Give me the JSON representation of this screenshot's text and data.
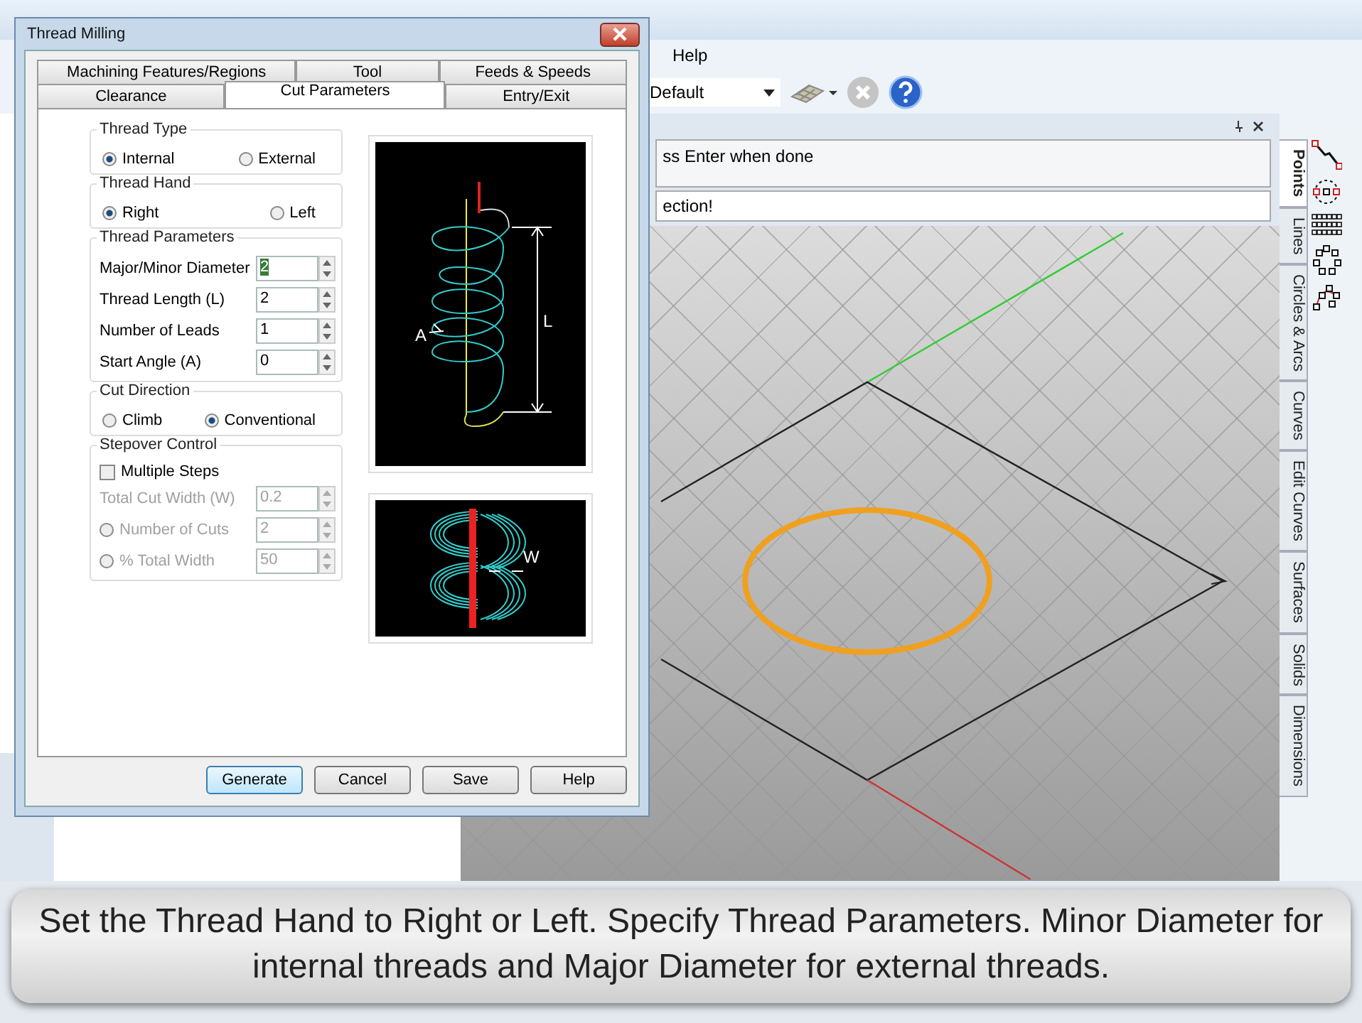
{
  "app": {
    "menu": [
      {
        "label": "Help"
      }
    ],
    "toolbar": {
      "view_dropdown": "Default"
    },
    "command_panel": {
      "prompt": "ss Enter when done",
      "message": "ection!"
    },
    "side_tabs": [
      {
        "label": "Points",
        "selected": true
      },
      {
        "label": "Lines",
        "selected": false
      },
      {
        "label": "Circles & Arcs",
        "selected": false
      },
      {
        "label": "Curves",
        "selected": false
      },
      {
        "label": "Edit Curves",
        "selected": false
      },
      {
        "label": "Surfaces",
        "selected": false
      },
      {
        "label": "Solids",
        "selected": false
      },
      {
        "label": "Dimensions",
        "selected": false
      }
    ]
  },
  "dialog": {
    "title": "Thread Milling",
    "tabs_back": [
      {
        "label": "Machining Features/Regions",
        "selected": false
      },
      {
        "label": "Tool",
        "selected": false
      },
      {
        "label": "Feeds & Speeds",
        "selected": false
      }
    ],
    "tabs_front": [
      {
        "label": "Clearance",
        "selected": false
      },
      {
        "label": "Cut Parameters",
        "selected": true
      },
      {
        "label": "Entry/Exit",
        "selected": false
      }
    ],
    "thread_type": {
      "title": "Thread Type",
      "options": [
        {
          "label": "Internal",
          "selected": true
        },
        {
          "label": "External",
          "selected": false
        }
      ]
    },
    "thread_hand": {
      "title": "Thread Hand",
      "options": [
        {
          "label": "Right",
          "selected": true
        },
        {
          "label": "Left",
          "selected": false
        }
      ]
    },
    "thread_parameters": {
      "title": "Thread Parameters",
      "fields": [
        {
          "label": "Major/Minor Diameter",
          "value": "2",
          "selected": true
        },
        {
          "label": "Thread Length (L)",
          "value": "2",
          "selected": false
        },
        {
          "label": "Number of Leads",
          "value": "1",
          "selected": false
        },
        {
          "label": "Start Angle (A)",
          "value": "0",
          "selected": false
        }
      ]
    },
    "cut_direction": {
      "title": "Cut Direction",
      "options": [
        {
          "label": "Climb",
          "selected": false
        },
        {
          "label": "Conventional",
          "selected": true
        }
      ]
    },
    "stepover_control": {
      "title": "Stepover Control",
      "multiple_steps": {
        "label": "Multiple Steps",
        "checked": false
      },
      "fields": [
        {
          "kind": "plain",
          "label": "Total Cut Width (W)",
          "value": "0.2",
          "disabled": true
        },
        {
          "kind": "radio",
          "label": "Number of Cuts",
          "value": "2",
          "selected": false,
          "disabled": true
        },
        {
          "kind": "radio",
          "label": "% Total Width",
          "value": "50",
          "selected": false,
          "disabled": true
        }
      ]
    },
    "thread_diagram": {
      "angle_label": "A",
      "length_label": "L"
    },
    "stepover_diagram": {
      "width_label": "W"
    },
    "buttons": [
      {
        "label": "Generate",
        "selected": true
      },
      {
        "label": "Cancel",
        "selected": false
      },
      {
        "label": "Save",
        "selected": false
      },
      {
        "label": "Help",
        "selected": false
      }
    ]
  },
  "caption": "Set the Thread Hand to Right or Left. Specify Thread Parameters. Minor Diameter for internal threads and Major Diameter for external threads."
}
